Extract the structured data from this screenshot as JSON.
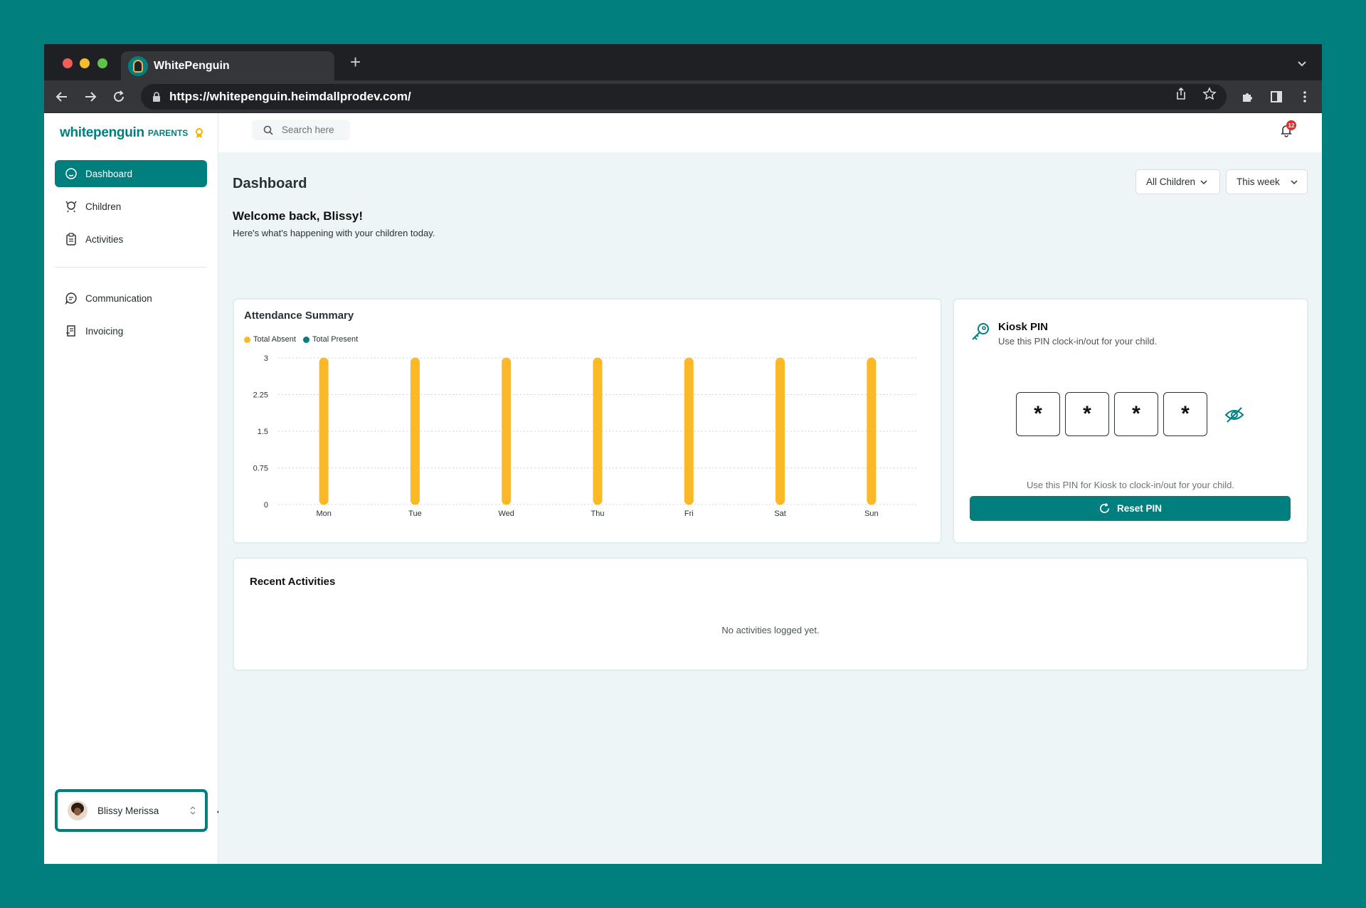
{
  "browser": {
    "tab_title": "WhitePenguin",
    "new_tab": "+",
    "url": "https://whitepenguin.heimdallprodev.com/"
  },
  "sidebar": {
    "logo": "whitepenguin",
    "logo_sub": "PARENTS",
    "primary_items": [
      {
        "label": "Dashboard",
        "icon": "home-icon",
        "active": true
      },
      {
        "label": "Children",
        "icon": "child-icon",
        "active": false
      },
      {
        "label": "Activities",
        "icon": "clipboard-icon",
        "active": false
      }
    ],
    "secondary_items": [
      {
        "label": "Communication",
        "icon": "chat-icon"
      },
      {
        "label": "Invoicing",
        "icon": "invoice-icon"
      }
    ],
    "user": {
      "name": "Blissy Merissa"
    }
  },
  "topbar": {
    "search_placeholder": "Search here",
    "notification_count": "12"
  },
  "dashboard": {
    "title": "Dashboard",
    "filters": {
      "children": "All Children",
      "period": "This week"
    },
    "welcome": "Welcome back, Blissy!",
    "welcome_sub": "Here's what's happening with your children today."
  },
  "attendance": {
    "title": "Attendance Summary",
    "legend": [
      {
        "label": "Total Absent",
        "color": "#fbb928"
      },
      {
        "label": "Total Present",
        "color": "#017f7e"
      }
    ]
  },
  "chart_data": {
    "type": "bar",
    "categories": [
      "Mon",
      "Tue",
      "Wed",
      "Thu",
      "Fri",
      "Sat",
      "Sun"
    ],
    "series": [
      {
        "name": "Total Absent",
        "values": [
          3,
          3,
          3,
          3,
          3,
          3,
          3
        ],
        "color": "#fbb928"
      },
      {
        "name": "Total Present",
        "values": [
          0,
          0,
          0,
          0,
          0,
          0,
          0
        ],
        "color": "#017f7e"
      }
    ],
    "yticks": [
      "0",
      "0.75",
      "1.5",
      "2.25",
      "3"
    ],
    "ylim": [
      0,
      3
    ],
    "grid": true,
    "legend_position": "top-left"
  },
  "kiosk": {
    "title": "Kiosk PIN",
    "subtitle": "Use this PIN clock-in/out for your child.",
    "pin_digits": [
      "*",
      "*",
      "*",
      "*"
    ],
    "hint": "Use this PIN for Kiosk to clock-in/out for your child.",
    "reset_label": "Reset PIN"
  },
  "activities": {
    "title": "Recent Activities",
    "empty": "No activities logged yet."
  },
  "colors": {
    "brand": "#017f7e",
    "absent": "#fbb928",
    "page_background": "#edf5f6"
  }
}
